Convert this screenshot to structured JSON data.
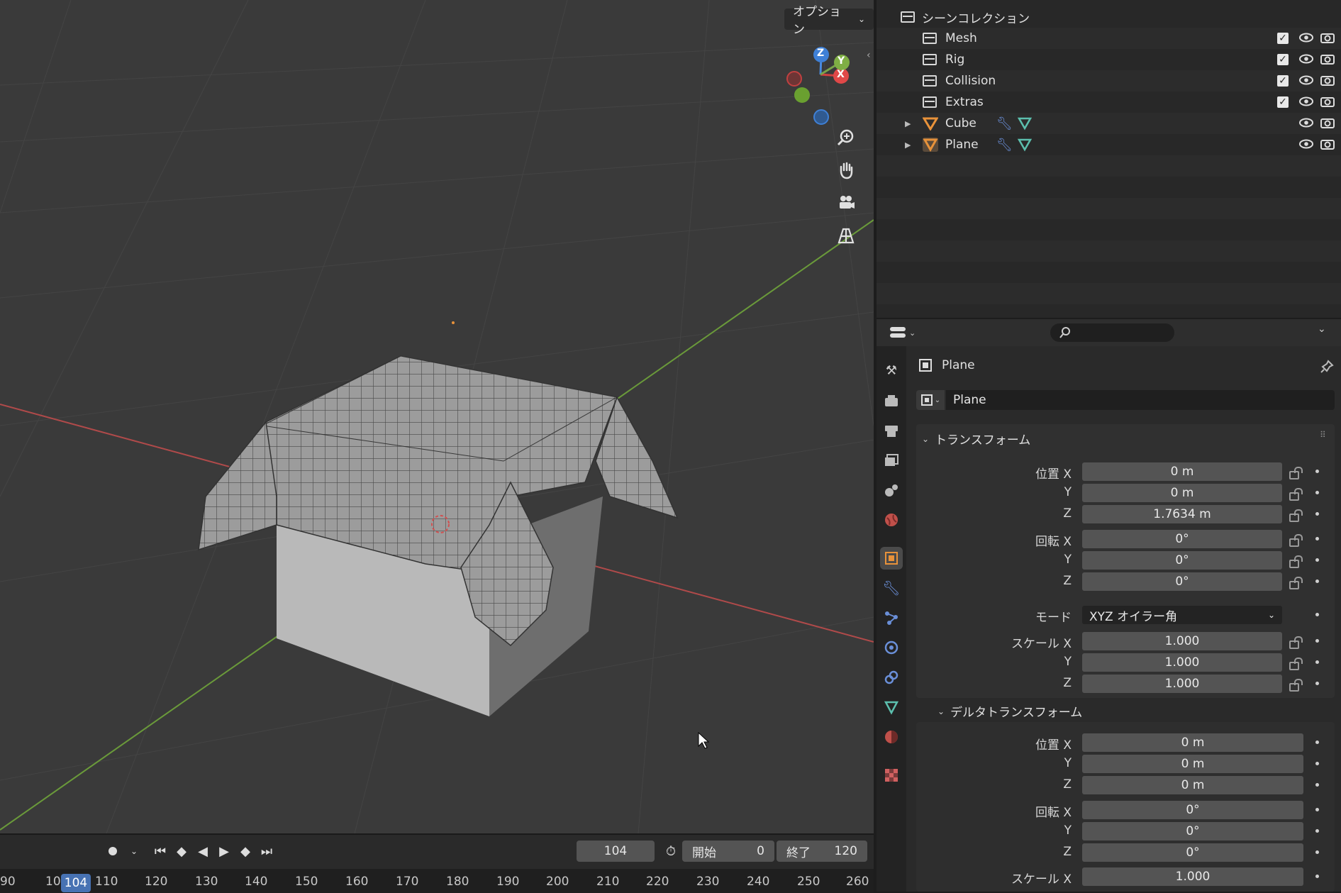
{
  "viewport": {
    "options_label": "オプション",
    "gizmo": {
      "z": "Z",
      "y": "Y",
      "x": "X"
    }
  },
  "timeline": {
    "current_frame": "104",
    "start_label": "開始",
    "start_value": "0",
    "end_label": "終了",
    "end_value": "120",
    "playhead_label": "104",
    "ticks": [
      "90",
      "10",
      "110",
      "120",
      "130",
      "140",
      "150",
      "160",
      "170",
      "180",
      "190",
      "200",
      "210",
      "220",
      "230",
      "240",
      "250",
      "260"
    ]
  },
  "outliner": {
    "root_label": "シーンコレクション",
    "items": [
      {
        "label": "Mesh",
        "type": "collection"
      },
      {
        "label": "Rig",
        "type": "collection"
      },
      {
        "label": "Collision",
        "type": "collection"
      },
      {
        "label": "Extras",
        "type": "collection"
      },
      {
        "label": "Cube",
        "type": "object"
      },
      {
        "label": "Plane",
        "type": "object"
      }
    ]
  },
  "properties": {
    "object_name": "Plane",
    "name_field": "Plane",
    "transform": {
      "header": "トランスフォーム",
      "location_label": "位置 X",
      "rotation_label": "回転 X",
      "mode_label": "モード",
      "scale_label": "スケール X",
      "y_label": "Y",
      "z_label": "Z",
      "location": [
        "0 m",
        "0 m",
        "1.7634 m"
      ],
      "rotation": [
        "0°",
        "0°",
        "0°"
      ],
      "mode_value": "XYZ オイラー角",
      "scale": [
        "1.000",
        "1.000",
        "1.000"
      ]
    },
    "delta": {
      "header": "デルタトランスフォーム",
      "location": [
        "0 m",
        "0 m",
        "0 m"
      ],
      "rotation": [
        "0°",
        "0°",
        "0°"
      ],
      "scale": [
        "1.000"
      ]
    }
  },
  "colors": {
    "accent": "#4772b3",
    "object_orange": "#e8923a",
    "data_green": "#5cbfae"
  }
}
